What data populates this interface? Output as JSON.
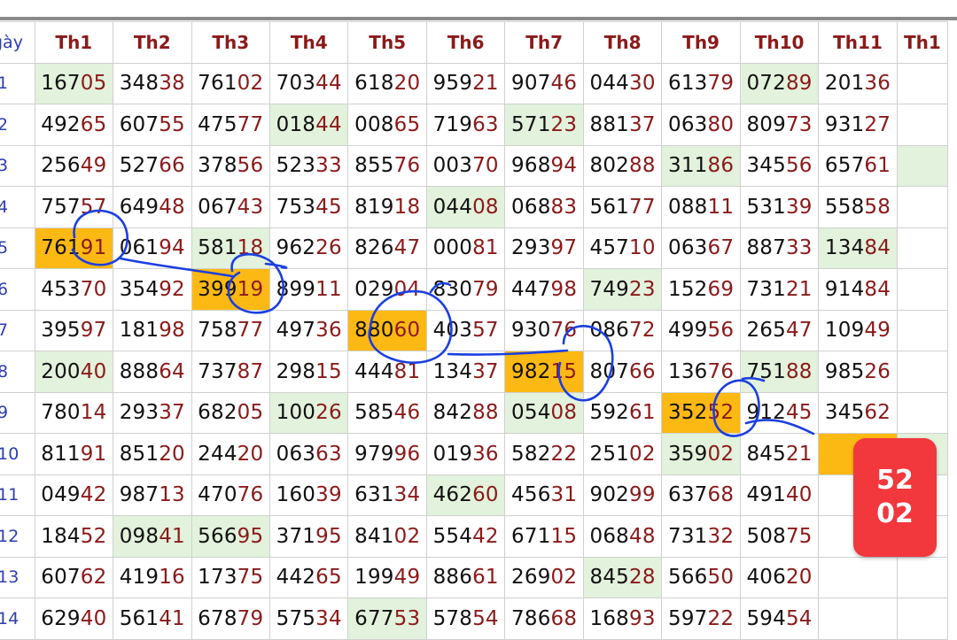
{
  "header": {
    "day_label": "gày",
    "columns": [
      "Th1",
      "Th2",
      "Th3",
      "Th4",
      "Th5",
      "Th6",
      "Th7",
      "Th8",
      "Th9",
      "Th10",
      "Th11",
      "Th1"
    ]
  },
  "rows": [
    {
      "day": "1",
      "cells": [
        {
          "v": "16705",
          "hl": "g"
        },
        {
          "v": "34838"
        },
        {
          "v": "76102"
        },
        {
          "v": "70344"
        },
        {
          "v": "61820"
        },
        {
          "v": "95921"
        },
        {
          "v": "90746"
        },
        {
          "v": "04430"
        },
        {
          "v": "61379"
        },
        {
          "v": "07289",
          "hl": "g"
        },
        {
          "v": "20136"
        },
        {
          "v": ""
        }
      ]
    },
    {
      "day": "2",
      "cells": [
        {
          "v": "49265"
        },
        {
          "v": "60755"
        },
        {
          "v": "47577"
        },
        {
          "v": "01844",
          "hl": "g"
        },
        {
          "v": "00865"
        },
        {
          "v": "71963"
        },
        {
          "v": "57123",
          "hl": "g"
        },
        {
          "v": "88137"
        },
        {
          "v": "06380"
        },
        {
          "v": "80973"
        },
        {
          "v": "93127"
        },
        {
          "v": ""
        }
      ]
    },
    {
      "day": "3",
      "cells": [
        {
          "v": "25649"
        },
        {
          "v": "52766"
        },
        {
          "v": "37856"
        },
        {
          "v": "52333"
        },
        {
          "v": "85576"
        },
        {
          "v": "00370"
        },
        {
          "v": "96894"
        },
        {
          "v": "80288"
        },
        {
          "v": "31186",
          "hl": "g"
        },
        {
          "v": "34556"
        },
        {
          "v": "65761"
        },
        {
          "v": "",
          "hl": "g"
        }
      ]
    },
    {
      "day": "4",
      "cells": [
        {
          "v": "75757"
        },
        {
          "v": "64948"
        },
        {
          "v": "06743"
        },
        {
          "v": "75345"
        },
        {
          "v": "81918"
        },
        {
          "v": "04408",
          "hl": "g"
        },
        {
          "v": "06883"
        },
        {
          "v": "56177"
        },
        {
          "v": "08811"
        },
        {
          "v": "53139"
        },
        {
          "v": "55858"
        },
        {
          "v": ""
        }
      ]
    },
    {
      "day": "5",
      "cells": [
        {
          "v": "76191",
          "hl": "o"
        },
        {
          "v": "06194"
        },
        {
          "v": "58118",
          "hl": "g"
        },
        {
          "v": "96226"
        },
        {
          "v": "82647"
        },
        {
          "v": "00081"
        },
        {
          "v": "29397"
        },
        {
          "v": "45710"
        },
        {
          "v": "06367"
        },
        {
          "v": "88733"
        },
        {
          "v": "13484",
          "hl": "g"
        },
        {
          "v": ""
        }
      ]
    },
    {
      "day": "6",
      "cells": [
        {
          "v": "45370"
        },
        {
          "v": "35492"
        },
        {
          "v": "39919",
          "hl": "o"
        },
        {
          "v": "89911"
        },
        {
          "v": "02904"
        },
        {
          "v": "83079"
        },
        {
          "v": "44798"
        },
        {
          "v": "74923",
          "hl": "g"
        },
        {
          "v": "15269"
        },
        {
          "v": "73121"
        },
        {
          "v": "91484"
        },
        {
          "v": ""
        }
      ]
    },
    {
      "day": "7",
      "cells": [
        {
          "v": "39597"
        },
        {
          "v": "18198"
        },
        {
          "v": "75877"
        },
        {
          "v": "49736"
        },
        {
          "v": "88060",
          "hl": "o"
        },
        {
          "v": "40357"
        },
        {
          "v": "93076"
        },
        {
          "v": "08672"
        },
        {
          "v": "49956"
        },
        {
          "v": "26547"
        },
        {
          "v": "10949"
        },
        {
          "v": ""
        }
      ]
    },
    {
      "day": "8",
      "cells": [
        {
          "v": "20040",
          "hl": "g"
        },
        {
          "v": "88864"
        },
        {
          "v": "73787"
        },
        {
          "v": "29815"
        },
        {
          "v": "44481"
        },
        {
          "v": "13437"
        },
        {
          "v": "98215",
          "hl": "o"
        },
        {
          "v": "80766"
        },
        {
          "v": "13676"
        },
        {
          "v": "75188",
          "hl": "g"
        },
        {
          "v": "98526"
        },
        {
          "v": ""
        }
      ]
    },
    {
      "day": "9",
      "cells": [
        {
          "v": "78014"
        },
        {
          "v": "29337"
        },
        {
          "v": "68205"
        },
        {
          "v": "10026",
          "hl": "g"
        },
        {
          "v": "58546"
        },
        {
          "v": "84288"
        },
        {
          "v": "05408",
          "hl": "g"
        },
        {
          "v": "59261"
        },
        {
          "v": "35252",
          "hl": "o"
        },
        {
          "v": "91245"
        },
        {
          "v": "34562"
        },
        {
          "v": ""
        }
      ]
    },
    {
      "day": "10",
      "cells": [
        {
          "v": "81191"
        },
        {
          "v": "85120"
        },
        {
          "v": "24420"
        },
        {
          "v": "06363"
        },
        {
          "v": "97996"
        },
        {
          "v": "01936"
        },
        {
          "v": "58222"
        },
        {
          "v": "25102"
        },
        {
          "v": "35902",
          "hl": "g"
        },
        {
          "v": "84521"
        },
        {
          "v": "",
          "hl": "o"
        },
        {
          "v": "",
          "hl": "g"
        }
      ]
    },
    {
      "day": "11",
      "cells": [
        {
          "v": "04942"
        },
        {
          "v": "98713"
        },
        {
          "v": "47076"
        },
        {
          "v": "16039"
        },
        {
          "v": "63134"
        },
        {
          "v": "46260",
          "hl": "g"
        },
        {
          "v": "45631"
        },
        {
          "v": "90299"
        },
        {
          "v": "63768"
        },
        {
          "v": "49140"
        },
        {
          "v": ""
        },
        {
          "v": ""
        }
      ]
    },
    {
      "day": "12",
      "cells": [
        {
          "v": "18452"
        },
        {
          "v": "09841",
          "hl": "g"
        },
        {
          "v": "56695",
          "hl": "g"
        },
        {
          "v": "37195"
        },
        {
          "v": "84102"
        },
        {
          "v": "55442"
        },
        {
          "v": "67115"
        },
        {
          "v": "06848"
        },
        {
          "v": "73132"
        },
        {
          "v": "50875"
        },
        {
          "v": ""
        },
        {
          "v": ""
        }
      ]
    },
    {
      "day": "13",
      "cells": [
        {
          "v": "60762"
        },
        {
          "v": "41916"
        },
        {
          "v": "17375"
        },
        {
          "v": "44265"
        },
        {
          "v": "19949"
        },
        {
          "v": "88661"
        },
        {
          "v": "26902"
        },
        {
          "v": "84528",
          "hl": "g"
        },
        {
          "v": "56650"
        },
        {
          "v": "40620"
        },
        {
          "v": ""
        },
        {
          "v": ""
        }
      ]
    },
    {
      "day": "14",
      "cells": [
        {
          "v": "62940"
        },
        {
          "v": "56141"
        },
        {
          "v": "67879"
        },
        {
          "v": "57534"
        },
        {
          "v": "67753",
          "hl": "g"
        },
        {
          "v": "57854"
        },
        {
          "v": "78668"
        },
        {
          "v": "16893"
        },
        {
          "v": "59722"
        },
        {
          "v": "59454"
        },
        {
          "v": ""
        },
        {
          "v": ""
        }
      ]
    }
  ],
  "badge": {
    "line1": "52",
    "line2": "02"
  },
  "colors": {
    "accent_red": "#8b1a1a",
    "day_blue": "#2c3eb0",
    "highlight_green": "#e2f2dc",
    "highlight_orange": "#fdb913",
    "badge_red": "#f2373d",
    "ink_blue": "#1b3fe0"
  }
}
